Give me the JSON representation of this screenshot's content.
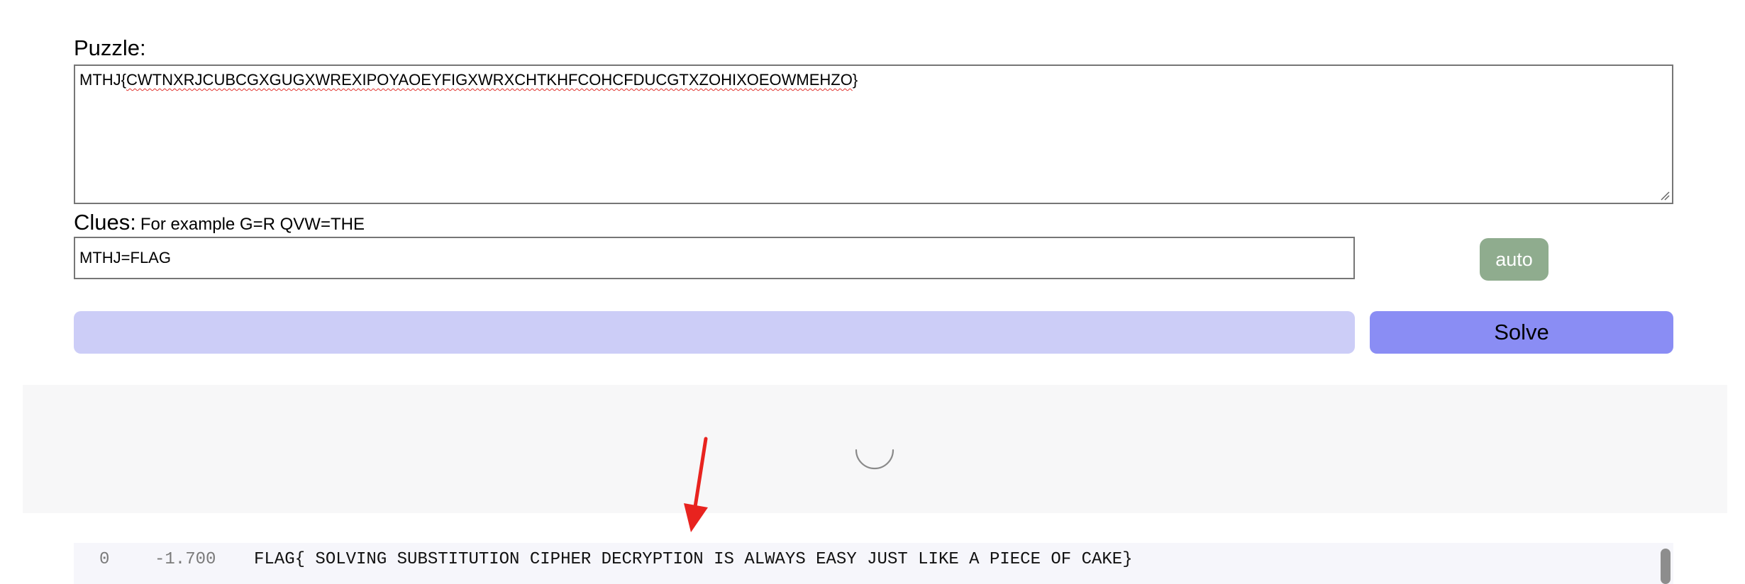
{
  "puzzle": {
    "label": "Puzzle:",
    "prefix": "MTHJ",
    "open_brace": "{",
    "body": "CWTNXRJCUBCGXGUGXWREXIPOYAOEYFIGXWRXCHTKHFCOHCFDUCGTXZOHIXOEOWMEHZO",
    "close_brace": "}"
  },
  "clues": {
    "label": "Clues:",
    "hint": "For example G=R QVW=THE",
    "value": "MTHJ=FLAG"
  },
  "buttons": {
    "auto": "auto",
    "solve": "Solve"
  },
  "results": [
    {
      "index": "0",
      "score": "-1.700",
      "text": "FLAG{ SOLVING SUBSTITUTION CIPHER DECRYPTION IS ALWAYS EASY JUST LIKE A PIECE OF CAKE}"
    }
  ],
  "colors": {
    "auto_button": "#8fac8e",
    "solve_button": "#8a8df4",
    "progress_track": "#cccdf7",
    "annotation_arrow": "#e8231f",
    "spellcheck": "#e0332e"
  }
}
